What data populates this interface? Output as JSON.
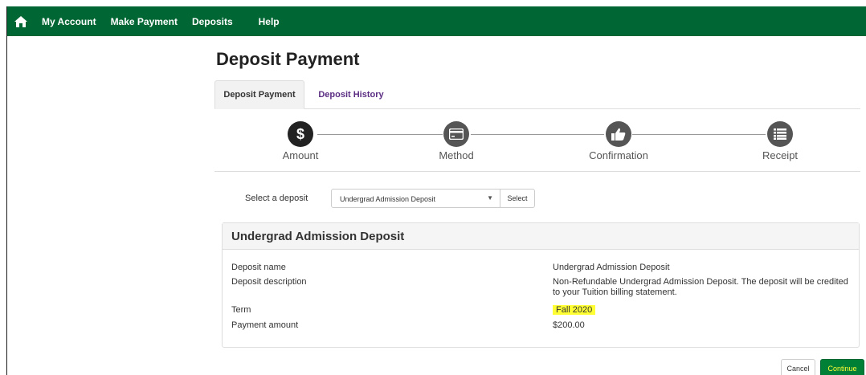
{
  "nav": {
    "home_icon": "home-icon",
    "items": [
      {
        "label": "My Account"
      },
      {
        "label": "Make Payment"
      },
      {
        "label": "Deposits"
      },
      {
        "label": "Help"
      }
    ]
  },
  "page": {
    "title": "Deposit Payment"
  },
  "tabs": [
    {
      "label": "Deposit Payment",
      "active": true
    },
    {
      "label": "Deposit History",
      "active": false
    }
  ],
  "steps": [
    {
      "label": "Amount",
      "icon": "dollar-icon",
      "state": "active"
    },
    {
      "label": "Method",
      "icon": "credit-card-icon",
      "state": "todo"
    },
    {
      "label": "Confirmation",
      "icon": "thumbs-up-icon",
      "state": "todo"
    },
    {
      "label": "Receipt",
      "icon": "list-icon",
      "state": "todo"
    }
  ],
  "deposit_select": {
    "label": "Select a deposit",
    "selected": "Undergrad Admission Deposit",
    "button": "Select"
  },
  "panel": {
    "title": "Undergrad Admission Deposit",
    "rows": [
      {
        "label": "Deposit name",
        "value": "Undergrad Admission Deposit"
      },
      {
        "label": "Deposit description",
        "value": "Non-Refundable Undergrad Admission Deposit. The deposit will be credited to your Tuition billing statement."
      },
      {
        "label": "Term",
        "value": "Fall 2020"
      },
      {
        "label": "Payment amount",
        "value": "$200.00"
      }
    ]
  },
  "actions": {
    "cancel": "Cancel",
    "continue": "Continue"
  },
  "colors": {
    "nav_bg": "#006633",
    "tab_link": "#5a2d82",
    "highlight": "#ffff33",
    "continue_bg": "#008037"
  }
}
